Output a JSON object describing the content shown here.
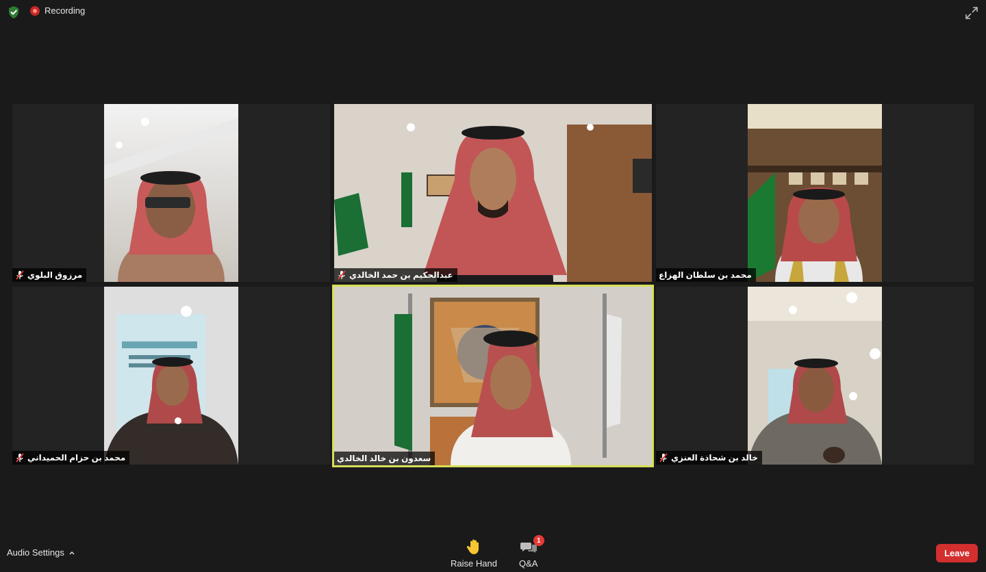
{
  "topbar": {
    "recording_label": "Recording"
  },
  "participants": [
    {
      "name": "مرزوق البلوي",
      "muted": true
    },
    {
      "name": "عبدالحكيم بن حمد الخالدي",
      "muted": true
    },
    {
      "name": "محمد بن سلطان الهزاع",
      "muted": false
    },
    {
      "name": "محمد بن حزام الحميداني",
      "muted": true
    },
    {
      "name": "سعدون بن خالد الخالدي",
      "muted": false,
      "active_speaker": true
    },
    {
      "name": "خالد بن شحاذة العنزي",
      "muted": true
    }
  ],
  "toolbar": {
    "audio_settings_label": "Audio Settings",
    "raise_hand_label": "Raise Hand",
    "qa_label": "Q&A",
    "qa_badge": "1",
    "leave_label": "Leave"
  },
  "colors": {
    "background": "#1a1a1a",
    "tile_background": "#232323",
    "speaker_highlight": "#d6df57",
    "leave_button": "#d32f2f",
    "badge": "#e53935",
    "security_shield": "#2e7d32"
  }
}
